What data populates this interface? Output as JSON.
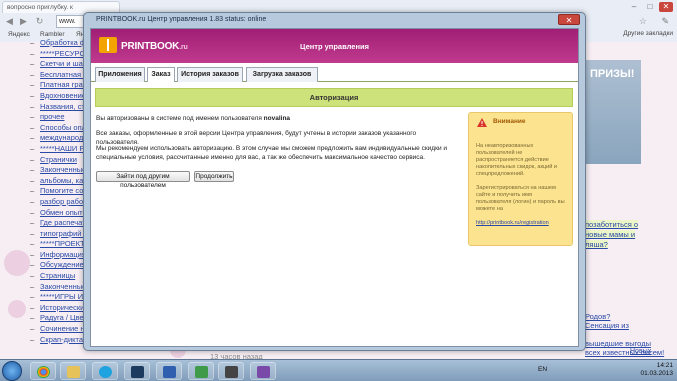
{
  "browser": {
    "tab_title": "вопросно приглубку. к",
    "address_text": "www.",
    "bookmarks": [
      "Яндекс",
      "Rambler",
      "Яндекс"
    ],
    "other_bookmarks": "Другие закладки",
    "window_controls": [
      "–",
      "□",
      "✕"
    ]
  },
  "page": {
    "left_links": [
      "Обработка фото",
      "*****РЕСУРСЫ",
      "Скетчи и шаблоны",
      "Бесплатная графика",
      "Платная графика",
      "Вдохновение",
      "Названия, стихи",
      "прочее",
      "Способы оплаты",
      "международных",
      "*****НАШИ РАБОТЫ",
      "Странички",
      "Законченные работы",
      "альбомы, календари",
      "Помогите советом",
      "разбор работ)",
      "Обмен опытом",
      "Где распечатать",
      "типографий и т.д.",
      "*****ПРОЕКТЫ",
      "Информация о",
      "Обсуждение проектов",
      "Страницы",
      "Законченные альбомы",
      "*****ИГРЫ И КОНКУРСЫ",
      "Исторический",
      "Радуга / Цвета",
      "Сочинение на тему",
      "Скрап-диктант"
    ],
    "ad_text": "ПРИЗЫ!",
    "right_links": [
      "позаботиться о",
      "новые мамы и",
      "ляша?",
      "Родов?",
      "Сенсация из",
      "вышедшие выгоды",
      "всех известных писем!",
      "Гарантия результата!"
    ],
    "bottom_time": "13 часов назад",
    "news_label": "Новых"
  },
  "modal": {
    "window_title": "PRINTBOOK.ru Центр управления 1.83 status: online",
    "close_glyph": "✕",
    "logo_text": "PRINTBOOK",
    "logo_suffix": ".ru",
    "center_title": "Центр управления",
    "tabs": [
      "Приложения",
      "Заказ",
      "История заказов",
      "Загрузка заказов"
    ],
    "active_tab": "Заказ",
    "auth_title": "Авторизация",
    "auth_line1_prefix": "Вы авторизованы в системе под именем пользователя",
    "auth_username": "novalina",
    "auth_line2": "Все заказы, оформленные в этой версии Центра управления, будут учтены в истории заказов указанного пользователя.",
    "auth_line3": "Мы рекомендуем использовать авторизацию. В этом случае мы сможем предложить вам индивидуальные скидки и специальные условия, рассчитанные именно для вас, а так же обеспечить максимальное качество сервиса.",
    "btn_other_user": "Зайти под другим пользователем",
    "btn_continue": "Продолжить",
    "warning": {
      "title": "Внимание",
      "text1": "На неавторизованных пользователей не распространяется действие накопительных скидок, акций и спецпредложений.",
      "text2": "Зарегистрироваться на нашем сайте и получить имя пользователя (логин) и пароль вы можете на",
      "link": "http://printbook.ru/registration"
    }
  },
  "taskbar": {
    "lang": "EN",
    "time": "14:21",
    "date": "01.03.2013"
  },
  "colors": {
    "header_magenta": "#b02c82",
    "auth_green": "#cde27a",
    "warn_yellow": "#fbe38f"
  }
}
